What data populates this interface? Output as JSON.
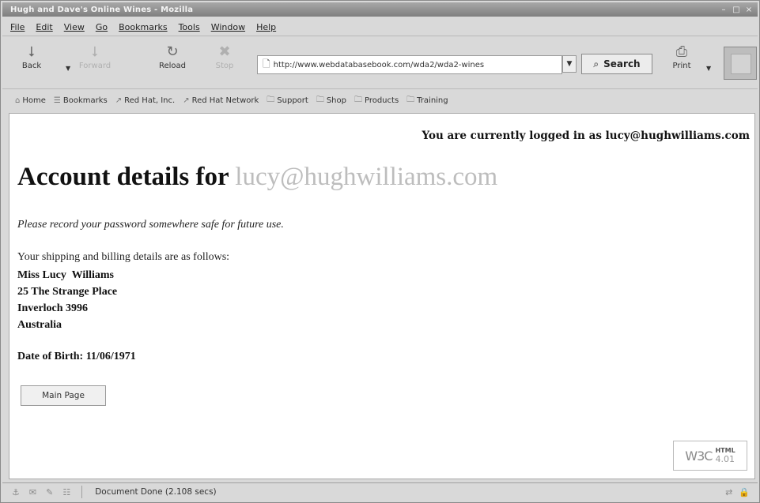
{
  "window": {
    "title": "Hugh and Dave's Online Wines - Mozilla",
    "controls": [
      "–",
      "□",
      "×"
    ]
  },
  "menu": [
    "File",
    "Edit",
    "View",
    "Go",
    "Bookmarks",
    "Tools",
    "Window",
    "Help"
  ],
  "toolbar": {
    "back": "Back",
    "forward": "Forward",
    "reload": "Reload",
    "stop": "Stop",
    "url": "http://www.webdatabasebook.com/wda2/wda2-wines",
    "search": "Search",
    "print": "Print"
  },
  "bookmarks": [
    "Home",
    "Bookmarks",
    "Red Hat, Inc.",
    "Red Hat Network",
    "Support",
    "Shop",
    "Products",
    "Training"
  ],
  "page": {
    "logged_in": "You are currently logged in as lucy@hughwilliams.com",
    "heading_prefix": "Account details for",
    "heading_email": "lucy@hughwilliams.com",
    "note": "Please record your password somewhere safe for future use.",
    "intro": "Your shipping and billing details are as follows:",
    "address": [
      "Miss Lucy  Williams",
      "25 The Strange Place",
      "Inverloch 3996",
      "Australia"
    ],
    "dob": "Date of Birth: 11/06/1971",
    "main_button": "Main Page",
    "w3c": {
      "logo": "W3C",
      "html": "HTML",
      "version": "4.01"
    }
  },
  "status": {
    "text": "Document Done (2.108 secs)"
  }
}
